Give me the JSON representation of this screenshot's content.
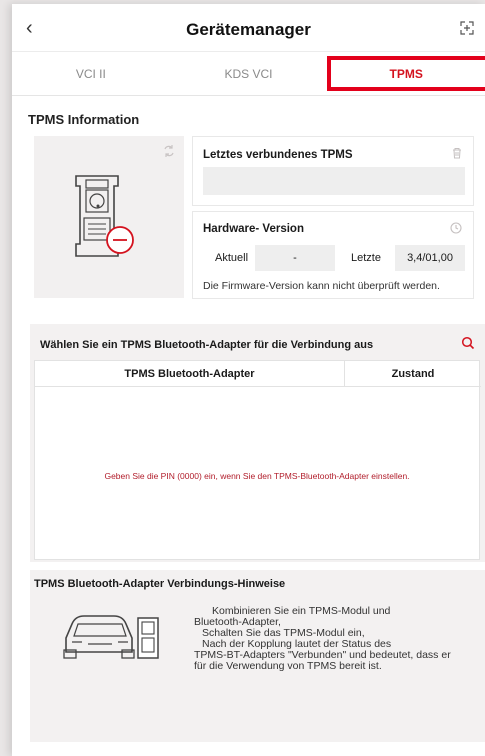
{
  "header": {
    "title": "Gerätemanager",
    "back_icon": "chevron-left-icon",
    "fullscreen_icon": "fullscreen-icon"
  },
  "tabs": [
    {
      "label": "VCI II",
      "active": false
    },
    {
      "label": "KDS VCI",
      "active": false
    },
    {
      "label": "TPMS",
      "active": true
    }
  ],
  "info": {
    "title": "TPMS Information",
    "last_connected_label": "Letztes verbundenes TPMS",
    "last_connected_value": "",
    "hardware_label": "Hardware- Version",
    "current_label": "Aktuell",
    "current_value": "-",
    "latest_label": "Letzte",
    "latest_value": "3,4/01,00",
    "firmware_note": "Die Firmware-Version kann nicht überprüft werden."
  },
  "adapter": {
    "heading": "Wählen Sie ein TPMS Bluetooth-Adapter für die Verbindung aus",
    "col_adapter": "TPMS Bluetooth-Adapter",
    "col_status": "Zustand",
    "empty_message": "Geben Sie die PIN (0000) ein, wenn Sie den TPMS-Bluetooth-Adapter einstellen."
  },
  "hints": {
    "heading": "TPMS Bluetooth-Adapter Verbindungs-Hinweise",
    "lines": [
      "Kombinieren Sie ein TPMS-Modul und",
      "Bluetooth-Adapter,",
      "Schalten Sie das TPMS-Modul ein,",
      "Nach der Kopplung lautet der Status des",
      "TPMS-BT-Adapters \"Verbunden\" und bedeutet, dass er",
      "für die Verwendung von TPMS bereit ist."
    ]
  },
  "colors": {
    "accent": "#d4121e",
    "highlight": "#e3001b"
  }
}
